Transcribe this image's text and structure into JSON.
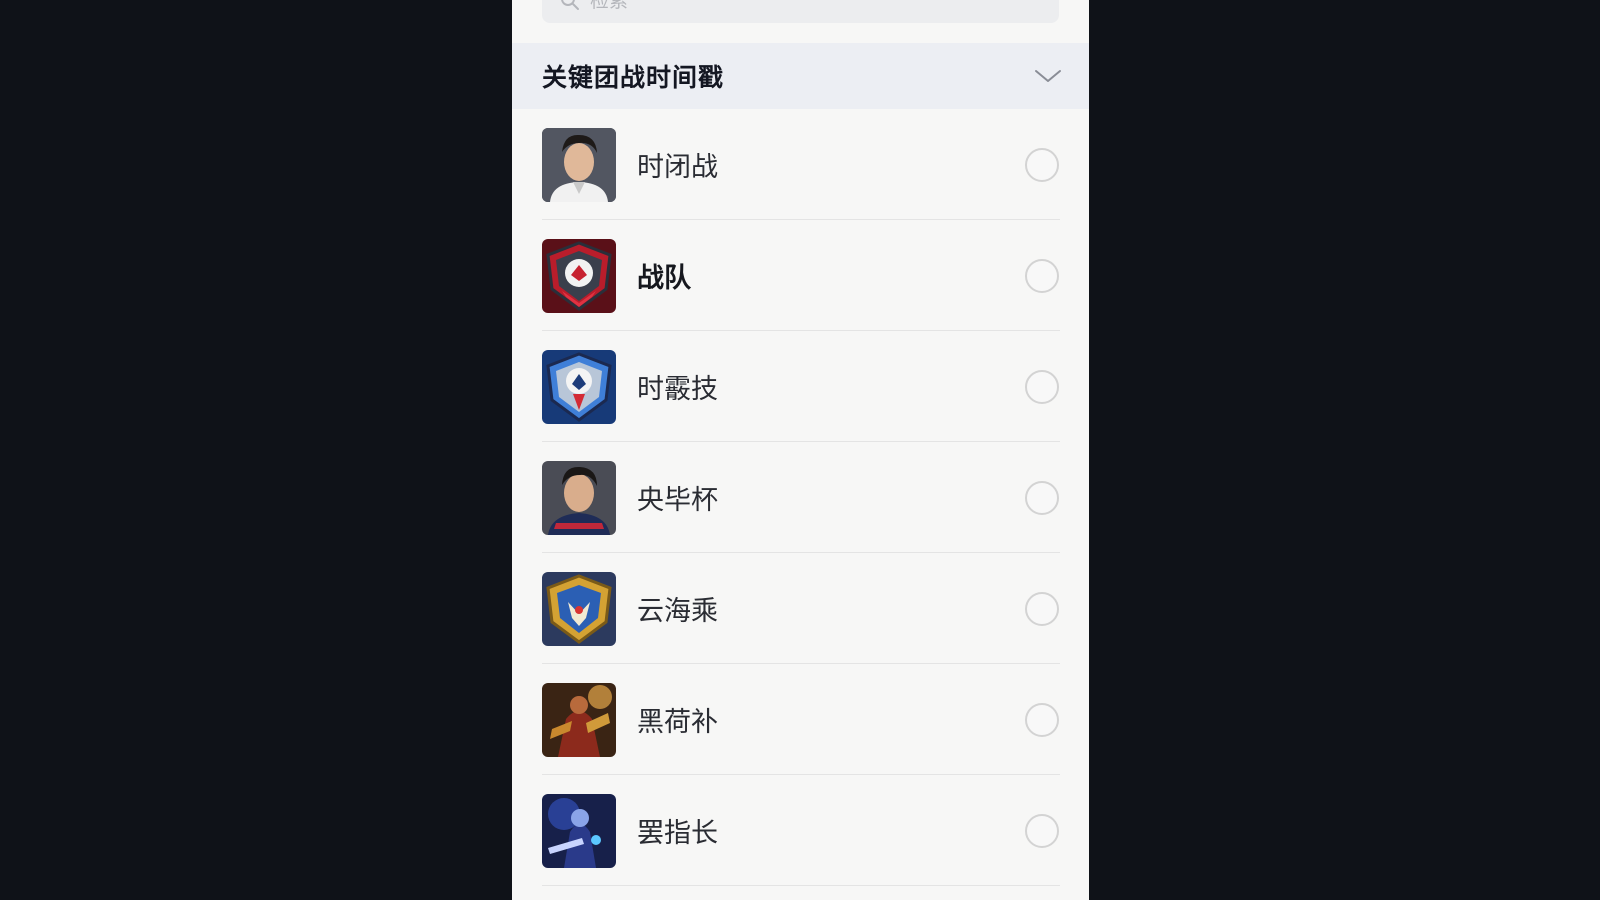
{
  "search": {
    "placeholder": "检索"
  },
  "section": {
    "title": "关键团战时间戳",
    "toggle_icon": "chevron-down-icon"
  },
  "items": [
    {
      "label": "时闭战",
      "avatar": "player-portrait-1",
      "selected": false,
      "bold": false
    },
    {
      "label": "战队",
      "avatar": "team-badge-red",
      "selected": false,
      "bold": true
    },
    {
      "label": "时霰技",
      "avatar": "team-badge-blue",
      "selected": false,
      "bold": false
    },
    {
      "label": "央毕杯",
      "avatar": "player-portrait-2",
      "selected": false,
      "bold": false
    },
    {
      "label": "云海乘",
      "avatar": "team-badge-gold",
      "selected": false,
      "bold": false
    },
    {
      "label": "黑荷补",
      "avatar": "hero-art-warrior",
      "selected": false,
      "bold": false
    },
    {
      "label": "罢指长",
      "avatar": "hero-art-blue",
      "selected": false,
      "bold": false
    }
  ],
  "colors": {
    "page_bg": "#0f1218",
    "panel_bg": "#f7f7f6",
    "header_bg": "#eceef3"
  }
}
